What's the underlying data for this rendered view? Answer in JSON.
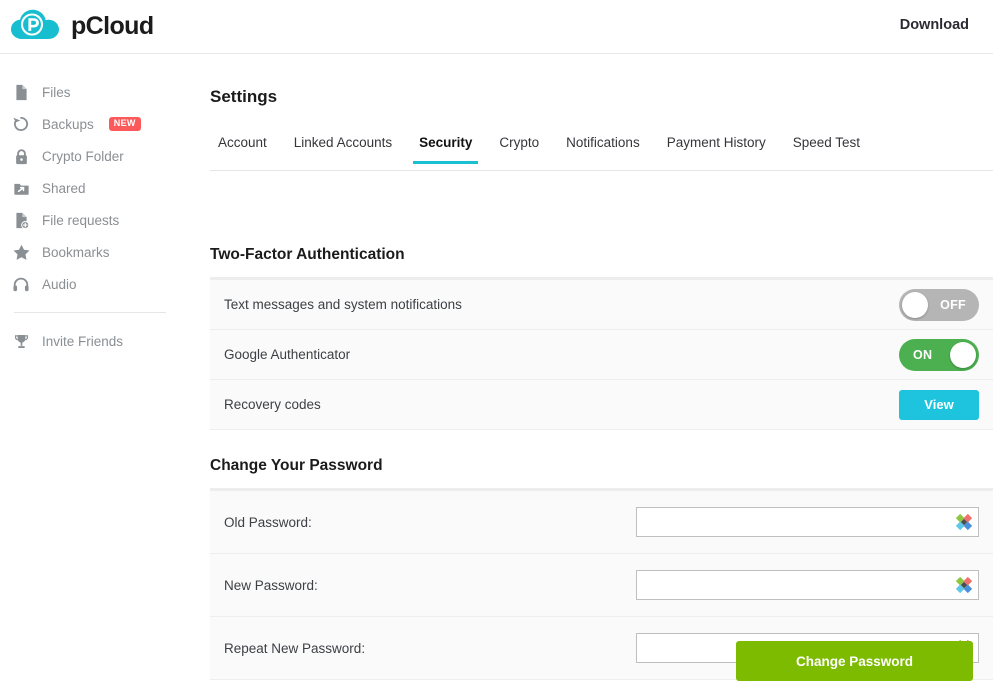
{
  "header": {
    "logo_icon": "pcloud-logo-icon",
    "brand": "pCloud",
    "download_label": "Download"
  },
  "sidebar": {
    "items": [
      {
        "label": "Files",
        "icon": "file-icon",
        "badge": null
      },
      {
        "label": "Backups",
        "icon": "backup-restore-icon",
        "badge": "NEW"
      },
      {
        "label": "Crypto Folder",
        "icon": "lock-icon",
        "badge": null
      },
      {
        "label": "Shared",
        "icon": "shared-folder-icon",
        "badge": null
      },
      {
        "label": "File requests",
        "icon": "file-plus-icon",
        "badge": null
      },
      {
        "label": "Bookmarks",
        "icon": "star-icon",
        "badge": null
      },
      {
        "label": "Audio",
        "icon": "headphones-icon",
        "badge": null
      },
      {
        "label": "Invite Friends",
        "icon": "trophy-icon",
        "badge": null
      }
    ]
  },
  "main": {
    "page_title": "Settings",
    "tabs": [
      {
        "label": "Account",
        "active": false
      },
      {
        "label": "Linked Accounts",
        "active": false
      },
      {
        "label": "Security",
        "active": true
      },
      {
        "label": "Crypto",
        "active": false
      },
      {
        "label": "Notifications",
        "active": false
      },
      {
        "label": "Payment History",
        "active": false
      },
      {
        "label": "Speed Test",
        "active": false
      }
    ],
    "two_factor": {
      "heading": "Two-Factor Authentication",
      "rows": [
        {
          "label": "Text messages and system notifications",
          "control": "toggle",
          "state": "OFF"
        },
        {
          "label": "Google Authenticator",
          "control": "toggle",
          "state": "ON"
        },
        {
          "label": "Recovery codes",
          "control": "button",
          "button_label": "View"
        }
      ]
    },
    "change_password": {
      "heading": "Change Your Password",
      "fields": [
        {
          "label": "Old Password:",
          "value": "",
          "placeholder": "",
          "icon": "password-manager-icon"
        },
        {
          "label": "New Password:",
          "value": "",
          "placeholder": "",
          "icon": "password-manager-icon"
        },
        {
          "label": "Repeat New Password:",
          "value": "",
          "placeholder": "",
          "icon": "password-manager-icon"
        }
      ],
      "submit_label": "Change Password"
    }
  },
  "colors": {
    "brand_cyan": "#19c0d4",
    "toggle_on_green": "#4cb050",
    "toggle_off_gray": "#b5b5b5",
    "view_button_cyan": "#1ec4dd",
    "submit_green": "#7cbb00",
    "badge_red": "#fc5a5a"
  }
}
